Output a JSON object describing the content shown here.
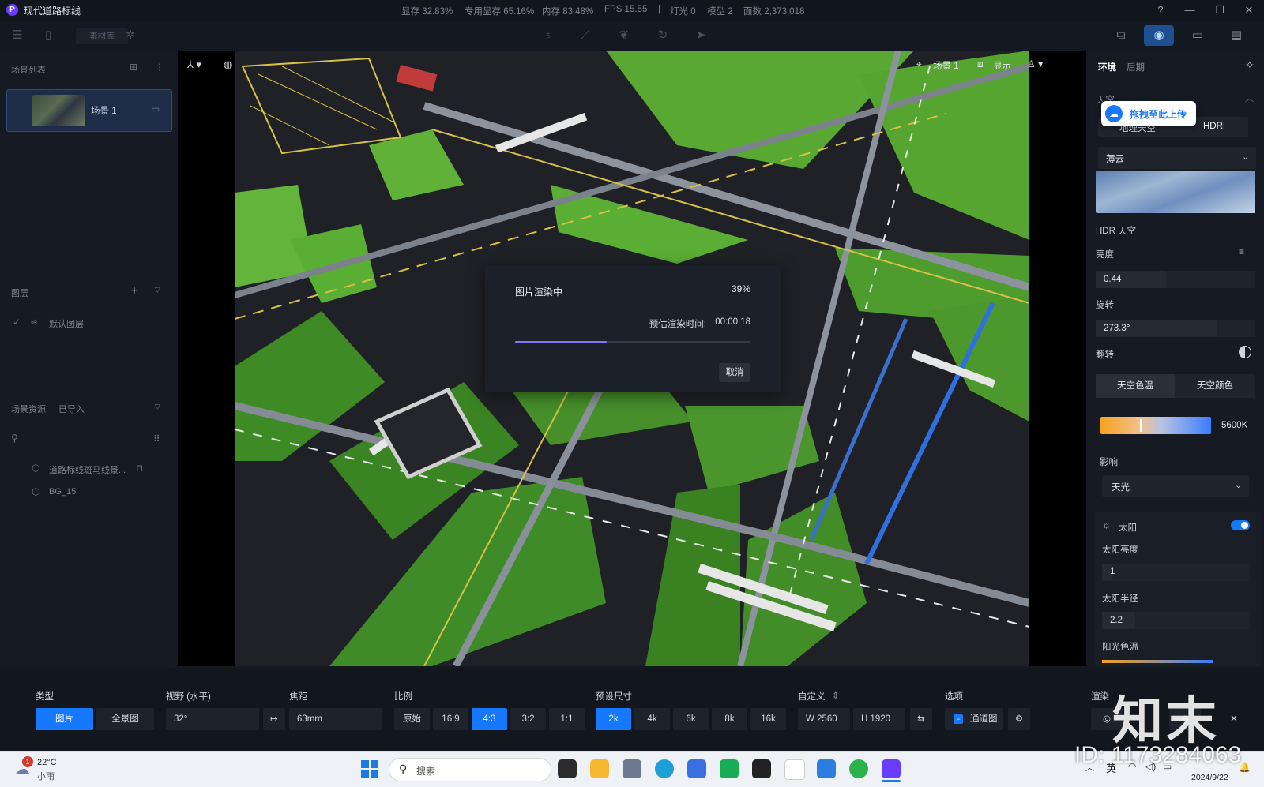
{
  "app": {
    "title": "现代道路标线",
    "logo_letter": "P",
    "stats": [
      "显存 32.83%",
      "专用显存 65.16%",
      "内存 83.48%",
      "FPS 15.55",
      "|",
      "灯光 0",
      "模型 2",
      "面数 2,373,018"
    ]
  },
  "toolbar": {
    "material_tab": "素材库"
  },
  "left_panel": {
    "scene_list_title": "场景列表",
    "scene_item": "场景 1",
    "layers_title": "图层",
    "default_layer": "默认图层",
    "assets_title": "场景资源",
    "assets_subtitle": "已导入",
    "assets": [
      "道路标线斑马线景...",
      "BG_15"
    ]
  },
  "viewport": {
    "scene_label": "场景 1",
    "display_label": "显示"
  },
  "render_dialog": {
    "title": "图片渲染中",
    "percent_label": "39%",
    "progress": 0.39,
    "eta_label": "预估渲染时间:",
    "eta_value": "00:00:18",
    "cancel": "取消"
  },
  "right_panel": {
    "tabs": [
      "环境",
      "后期"
    ],
    "sky_title": "天空",
    "upload_tooltip": "拖拽至此上传",
    "sky_tabs": [
      "地理天空",
      "HDRI"
    ],
    "sky_preset": "薄云",
    "hdr_label": "HDR 天空",
    "brightness_label": "亮度",
    "brightness_value": "0.44",
    "brightness_level": 0.44,
    "rotation_label": "旋转",
    "rotation_value": "273.3°",
    "rotation_level": 0.76,
    "flip_label": "翻转",
    "color_tabs": [
      "天空色温",
      "天空颜色"
    ],
    "color_temp": "5600K",
    "influence_label": "影响",
    "influence_value": "天光",
    "sun_label": "太阳",
    "sun_brightness_label": "太阳亮度",
    "sun_brightness_value": "1",
    "sun_radius_label": "太阳半径",
    "sun_radius_value": "2.2",
    "sun_color_label": "阳光色温"
  },
  "bottom_bar": {
    "type_label": "类型",
    "type_options": [
      "图片",
      "全景图"
    ],
    "fov_label": "视野 (水平)",
    "fov_value": "32°",
    "focal_label": "焦距",
    "focal_value": "63mm",
    "ratio_label": "比例",
    "ratio_options": [
      "原始",
      "16:9",
      "4:3",
      "3:2",
      "1:1"
    ],
    "ratio_selected": "4:3",
    "preset_label": "预设尺寸",
    "preset_options": [
      "2k",
      "4k",
      "6k",
      "8k",
      "16k"
    ],
    "preset_selected": "2k",
    "custom_label": "自定义",
    "width_value": "W 2560",
    "height_value": "H 1920",
    "options_label": "选项",
    "channel_label": "通道图",
    "render_label": "渲染"
  },
  "taskbar": {
    "weather_temp": "22°C",
    "weather_desc": "小雨",
    "weather_badge": "1",
    "search_placeholder": "搜索",
    "ime": "英",
    "date": "2024/9/22"
  },
  "watermark": {
    "brand": "知末",
    "id": "ID: 1173284063"
  },
  "colors": {
    "accent": "#1677ff",
    "progress": "#8a72ff",
    "grass": "#4e9a2c",
    "road": "#1d1f24"
  }
}
